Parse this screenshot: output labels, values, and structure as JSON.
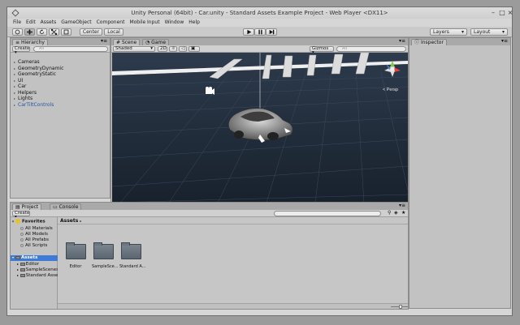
{
  "window": {
    "title": "Unity Personal (64bit) - Car.unity - Standard Assets Example Project - Web Player <DX11>",
    "minimize": "–",
    "maximize": "□",
    "close": "×"
  },
  "menu": [
    "File",
    "Edit",
    "Assets",
    "GameObject",
    "Component",
    "Mobile Input",
    "Window",
    "Help"
  ],
  "toolbar": {
    "center_label": "Center",
    "local_label": "Local",
    "layers_label": "Layers",
    "layout_label": "Layout",
    "tools": [
      "hand-tool",
      "move-tool",
      "rotate-tool",
      "scale-tool",
      "rect-tool"
    ],
    "playback": [
      "play-icon",
      "pause-icon",
      "step-icon"
    ]
  },
  "hierarchy": {
    "tab": "Hierarchy",
    "create_label": "Create",
    "search_placeholder": "All",
    "items": [
      {
        "label": "Cameras",
        "color": "#111111"
      },
      {
        "label": "GeometryDynamic",
        "color": "#111111"
      },
      {
        "label": "GeometryStatic",
        "color": "#111111"
      },
      {
        "label": "UI",
        "color": "#111111"
      },
      {
        "label": "Car",
        "color": "#111111"
      },
      {
        "label": "Helpers",
        "color": "#111111"
      },
      {
        "label": "Lights",
        "color": "#111111"
      },
      {
        "label": "CarTiltControls",
        "color": "#2155a6"
      }
    ]
  },
  "scene": {
    "tab_scene": "Scene",
    "tab_game": "Game",
    "shading_mode": "Shaded",
    "mode_2d": "2D",
    "gizmos_label": "Gizmos",
    "search_placeholder": "All",
    "persp_label": "< Persp",
    "sky_color": "#1f2a38",
    "grid_color": "#3d4d63"
  },
  "inspector": {
    "tab": "Inspector"
  },
  "project": {
    "tab_project": "Project",
    "tab_console": "Console",
    "create_label": "Create",
    "favorites_label": "Favorites",
    "favorites": [
      "All Materials",
      "All Models",
      "All Prefabs",
      "All Scripts"
    ],
    "assets_root": "Assets",
    "asset_folders": [
      "Editor",
      "SampleScenes",
      "Standard Assets"
    ],
    "breadcrumb": "Assets",
    "breadcrumb_arrow": "▸",
    "grid_items": [
      {
        "label": "Editor"
      },
      {
        "label": "SampleSce..."
      },
      {
        "label": "Standard A..."
      }
    ]
  }
}
